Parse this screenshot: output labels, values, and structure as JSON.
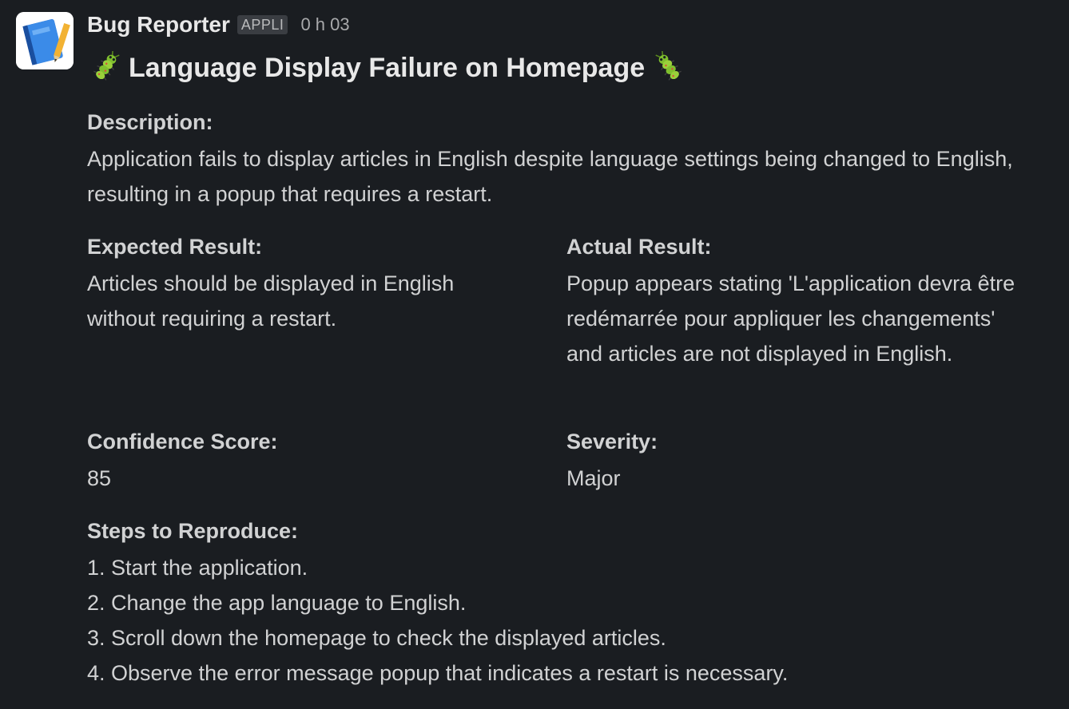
{
  "message": {
    "sender": "Bug Reporter",
    "badge": "APPLI",
    "timestamp": "0 h 03",
    "title": "Language Display Failure on Homepage",
    "title_emoji": "bug-icon"
  },
  "fields": {
    "description": {
      "label": "Description:",
      "value": "Application fails to display articles in English despite language settings being changed to English, resulting in a popup that requires a restart."
    },
    "expected": {
      "label": "Expected Result:",
      "value": "Articles should be displayed in English without requiring a restart."
    },
    "actual": {
      "label": "Actual Result:",
      "value": "Popup appears stating 'L'application devra être redémarrée pour appliquer les changements' and articles are not displayed in English."
    },
    "confidence": {
      "label": "Confidence Score:",
      "value": "85"
    },
    "severity": {
      "label": "Severity:",
      "value": "Major"
    }
  },
  "steps": {
    "label": "Steps to Reproduce:",
    "items": [
      "1. Start the application.",
      "2. Change the app language to English.",
      "3. Scroll down the homepage to check the displayed articles.",
      "4. Observe the error message popup that indicates a restart is necessary."
    ]
  },
  "colors": {
    "background": "#1a1d21",
    "text": "#d1d2d3",
    "badge_bg": "#3a3d42"
  }
}
